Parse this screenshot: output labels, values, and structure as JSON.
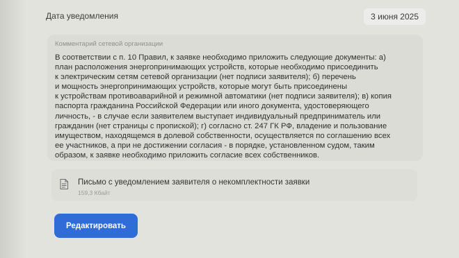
{
  "notification": {
    "date_label": "Дата уведомления",
    "date_value": "3 июня 2025"
  },
  "comment": {
    "caption": "Комментарий сетевой организации",
    "lines": [
      "В соответствии с п. 10 Правил, к заявке необходимо приложить следующие документы: а)",
      "план расположения энергопринимающих устройств, которые необходимо присоединить",
      "к электрическим сетям сетевой организации (нет подписи заявителя); б) перечень",
      "и мощность энергопринимающих устройств, которые могут быть присоединены",
      "к устройствам противоаварийной и режимной автоматики (нет подписи заявителя); в) копия",
      "паспорта гражданина Российской Федерации или иного документа, удостоверяющего",
      "личность, - в случае если заявителем выступает индивидуальный предприниматель или",
      "гражданин (нет страницы с пропиской); г) согласно ст. 247 ГК РФ, владение и пользование",
      "имуществом, находящемся в долевой собственности, осуществляется по соглашению всех",
      "ее участников, а при не достижении согласия - в порядке, установленном судом, таким",
      "образом, к заявке необходимо приложить согласие всех собственников."
    ]
  },
  "attachment": {
    "icon": "document-icon",
    "title": "Письмо с уведомлением заявителя о некомплектности заявки",
    "size": "159,3 Кбайт"
  },
  "actions": {
    "edit_label": "Редактировать",
    "edit_color": "#2f6cd8"
  }
}
